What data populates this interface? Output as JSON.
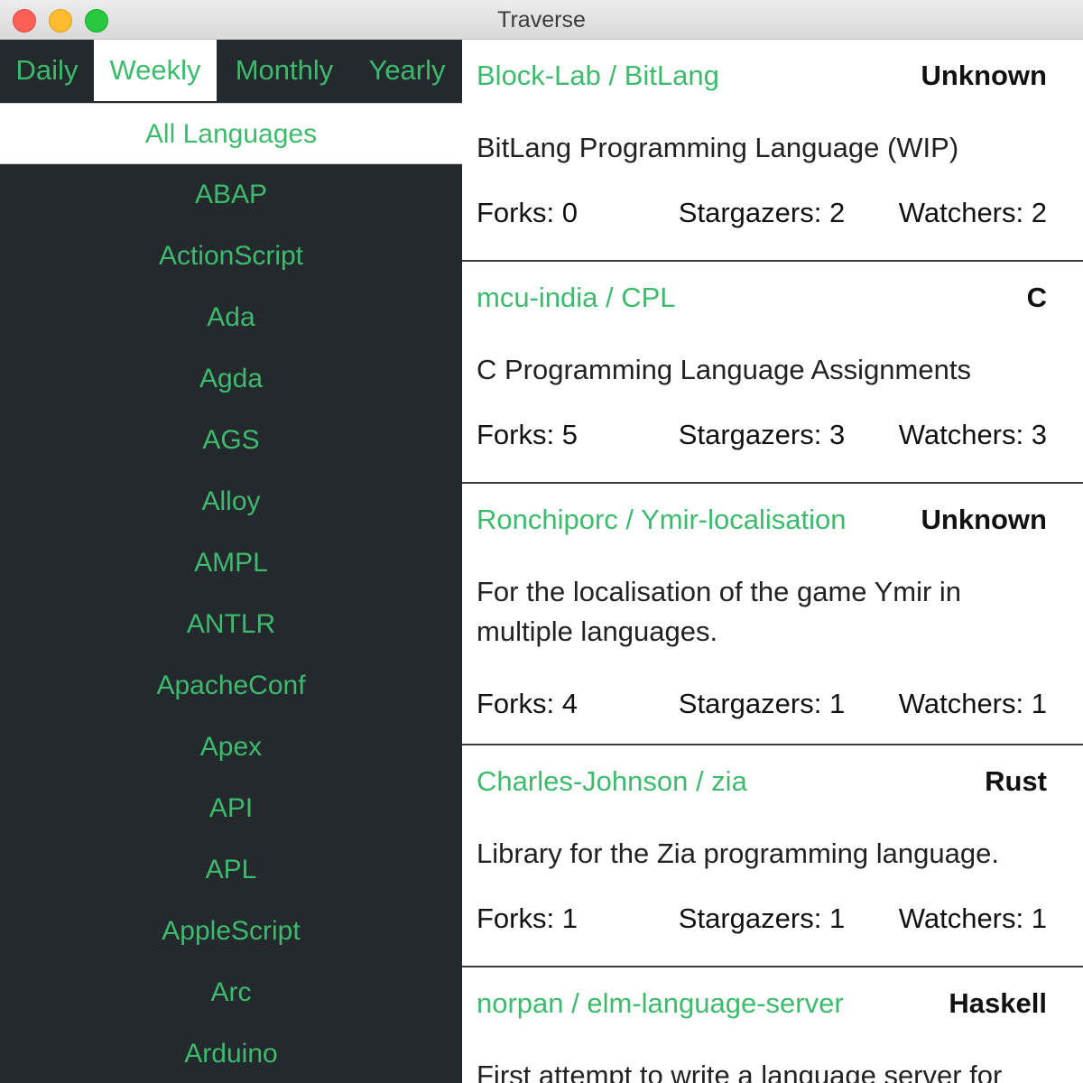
{
  "window": {
    "title": "Traverse"
  },
  "tabs": [
    {
      "label": "Daily",
      "active": false
    },
    {
      "label": "Weekly",
      "active": true
    },
    {
      "label": "Monthly",
      "active": false
    },
    {
      "label": "Yearly",
      "active": false
    }
  ],
  "languages": [
    "All Languages",
    "ABAP",
    "ActionScript",
    "Ada",
    "Agda",
    "AGS",
    "Alloy",
    "AMPL",
    "ANTLR",
    "ApacheConf",
    "Apex",
    "API",
    "APL",
    "AppleScript",
    "Arc",
    "Arduino"
  ],
  "selected_language": "All Languages",
  "stats_labels": {
    "forks": "Forks:",
    "stars": "Stargazers:",
    "watchers": "Watchers:"
  },
  "repos": [
    {
      "name": "Block-Lab / BitLang",
      "language": "Unknown",
      "description": "BitLang Programming Language (WIP)",
      "forks": "0",
      "stars": "2",
      "watchers": "2"
    },
    {
      "name": "mcu-india / CPL",
      "language": "C",
      "description": "C Programming Language Assignments",
      "forks": "5",
      "stars": "3",
      "watchers": "3"
    },
    {
      "name": "Ronchiporc / Ymir-localisation",
      "language": "Unknown",
      "description": "For the localisation of the game Ymir in multiple languages.",
      "forks": "4",
      "stars": "1",
      "watchers": "1"
    },
    {
      "name": "Charles-Johnson / zia",
      "language": "Rust",
      "description": "Library for the Zia programming language.",
      "forks": "1",
      "stars": "1",
      "watchers": "1"
    },
    {
      "name": "norpan / elm-language-server",
      "language": "Haskell",
      "description": "First attempt to write a language server for",
      "forks": "",
      "stars": "",
      "watchers": ""
    }
  ],
  "colors": {
    "accent": "#3dbb6c",
    "sidebar": "#24292e"
  }
}
